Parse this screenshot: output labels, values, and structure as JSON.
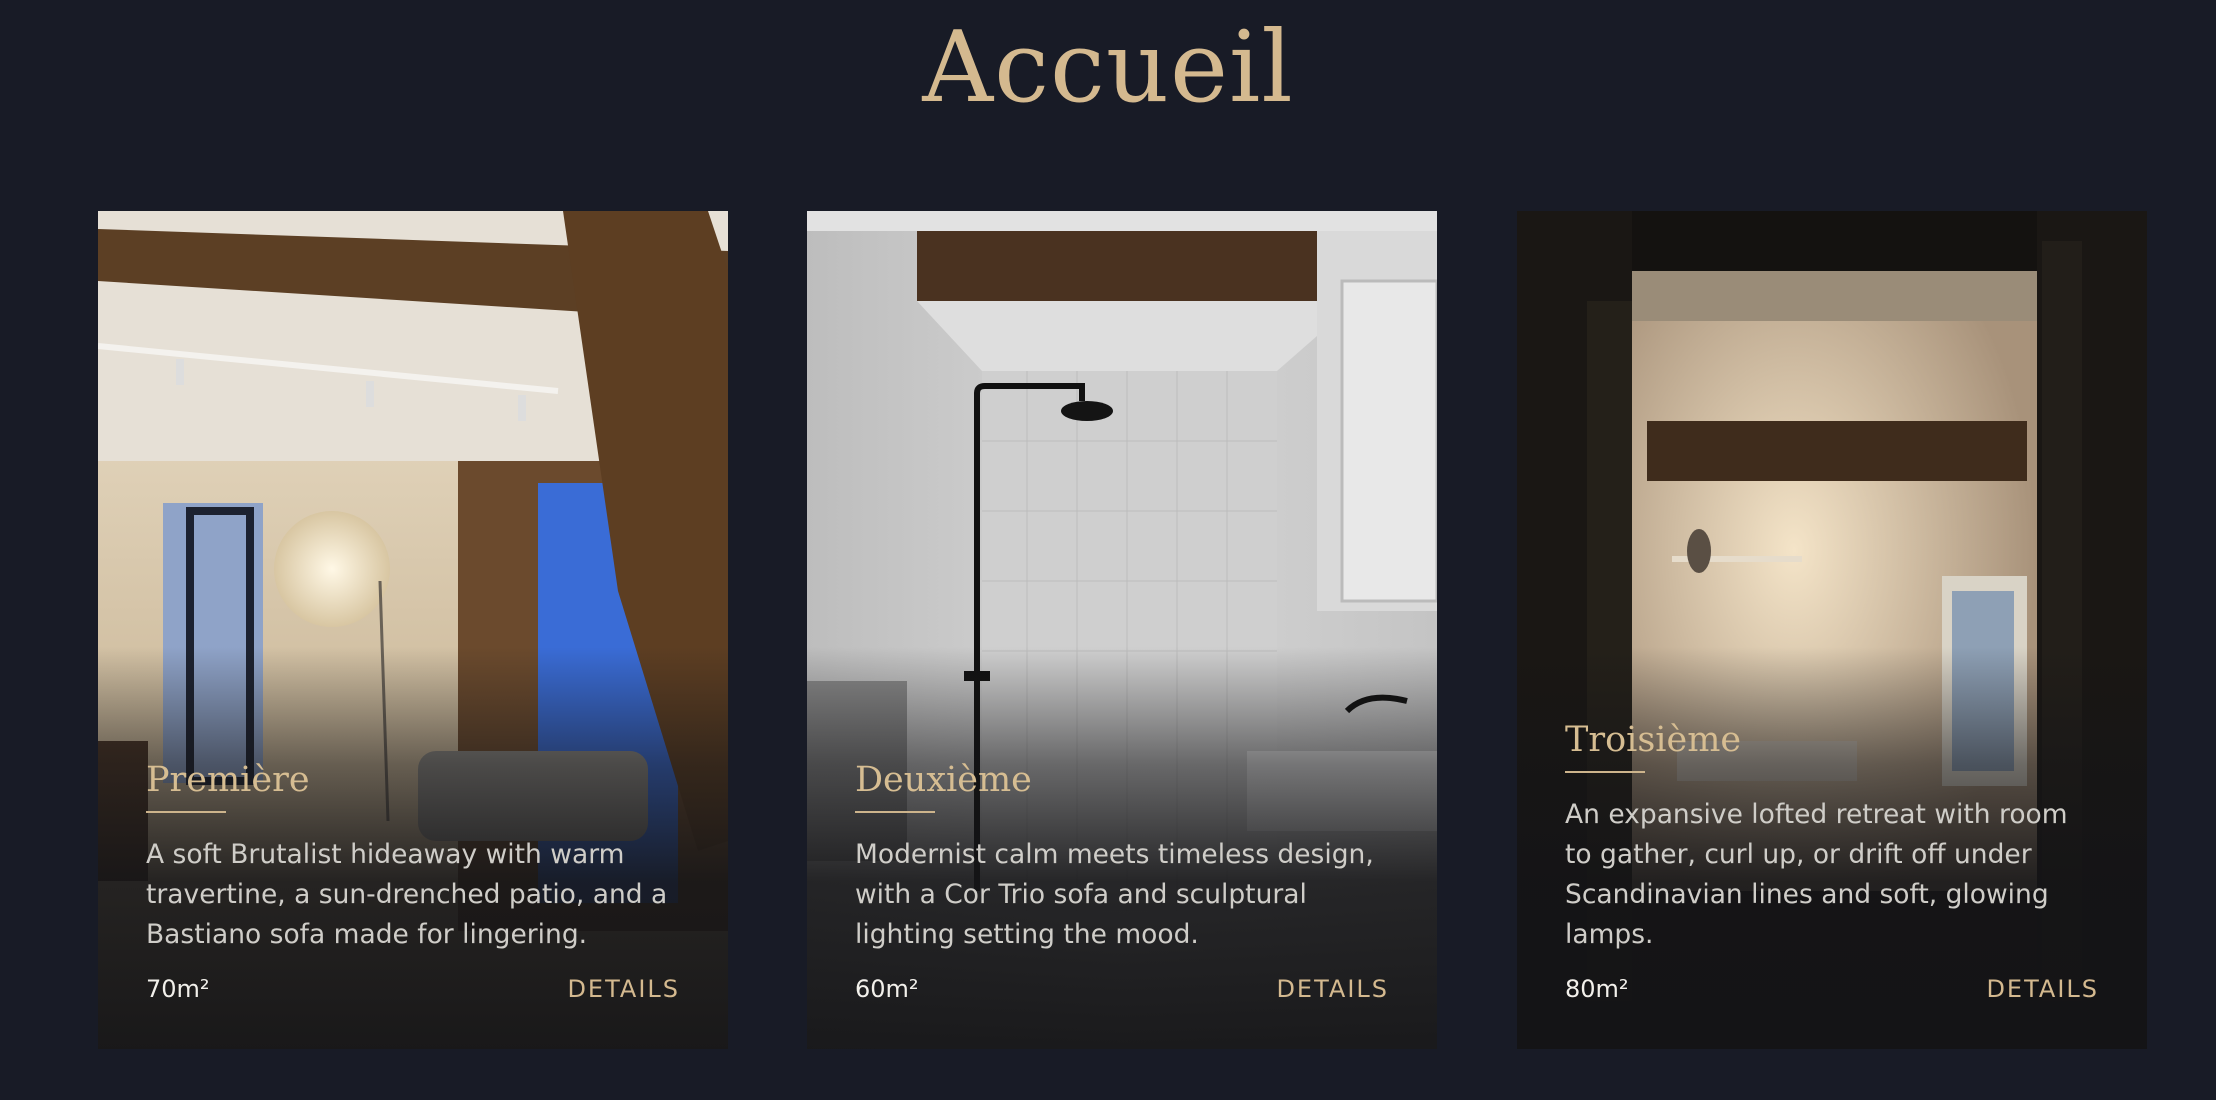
{
  "page": {
    "title": "Accueil"
  },
  "cards": [
    {
      "title": "Première",
      "description": "A soft Brutalist hideaway with warm travertine, a sun-drenched patio, and a Bastiano sofa made for lingering.",
      "area": "70m²",
      "link_label": "DETAILS"
    },
    {
      "title": "Deuxième",
      "description": "Modernist calm meets timeless design, with a Cor Trio sofa and sculptural lighting setting the mood.",
      "area": "60m²",
      "link_label": "DETAILS"
    },
    {
      "title": "Troisième",
      "description": "An expansive lofted retreat with room to gather, curl up, or drift off under Scandinavian lines and soft, glowing lamps.",
      "area": "80m²",
      "link_label": "DETAILS"
    }
  ],
  "colors": {
    "background": "#181b26",
    "accent": "#d4b98f",
    "text": "#cfcdc8"
  }
}
